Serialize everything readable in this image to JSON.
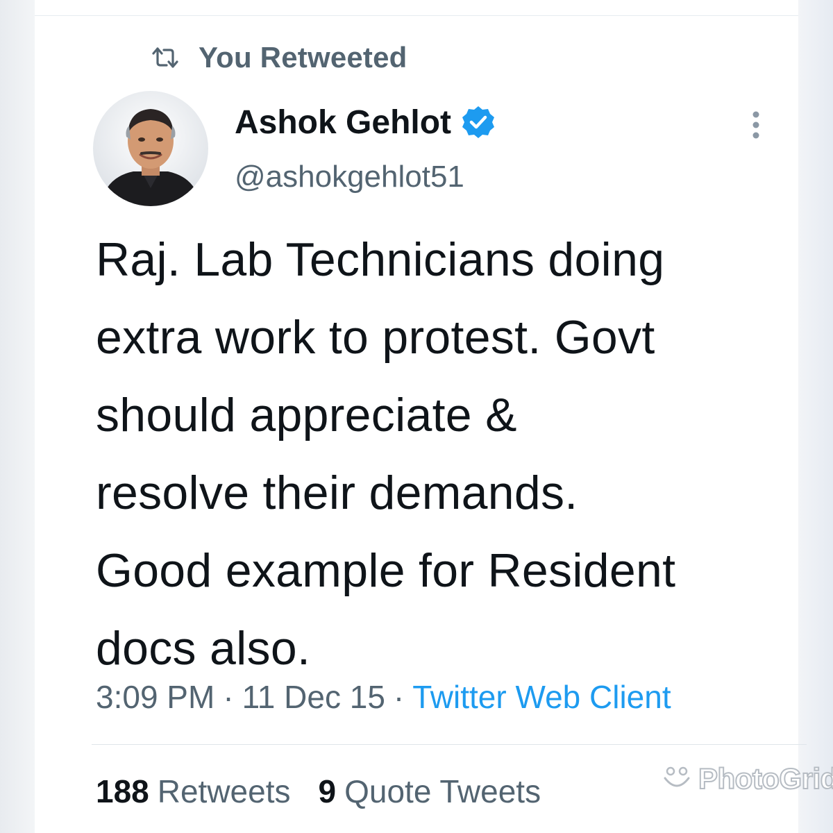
{
  "retweet": {
    "label": "You Retweeted",
    "icon": "retweet-icon"
  },
  "author": {
    "name": "Ashok Gehlot",
    "handle": "@ashokgehlot51",
    "verified": true,
    "verified_color": "#1d9bf0"
  },
  "tweet": {
    "text": "Raj. Lab Technicians doing\nextra work to protest. Govt\nshould appreciate &\nresolve their demands.\nGood example for Resident\ndocs also."
  },
  "meta": {
    "time": "3:09 PM",
    "separator": "·",
    "date": "11 Dec 15",
    "client": "Twitter Web Client"
  },
  "stats": {
    "retweets_count": "188",
    "retweets_label": "Retweets",
    "quotes_count": "9",
    "quotes_label": "Quote Tweets"
  },
  "watermark": {
    "text": "PhotoGrid"
  },
  "colors": {
    "text_primary": "#0f1419",
    "text_secondary": "#536471",
    "link": "#1d9bf0"
  }
}
